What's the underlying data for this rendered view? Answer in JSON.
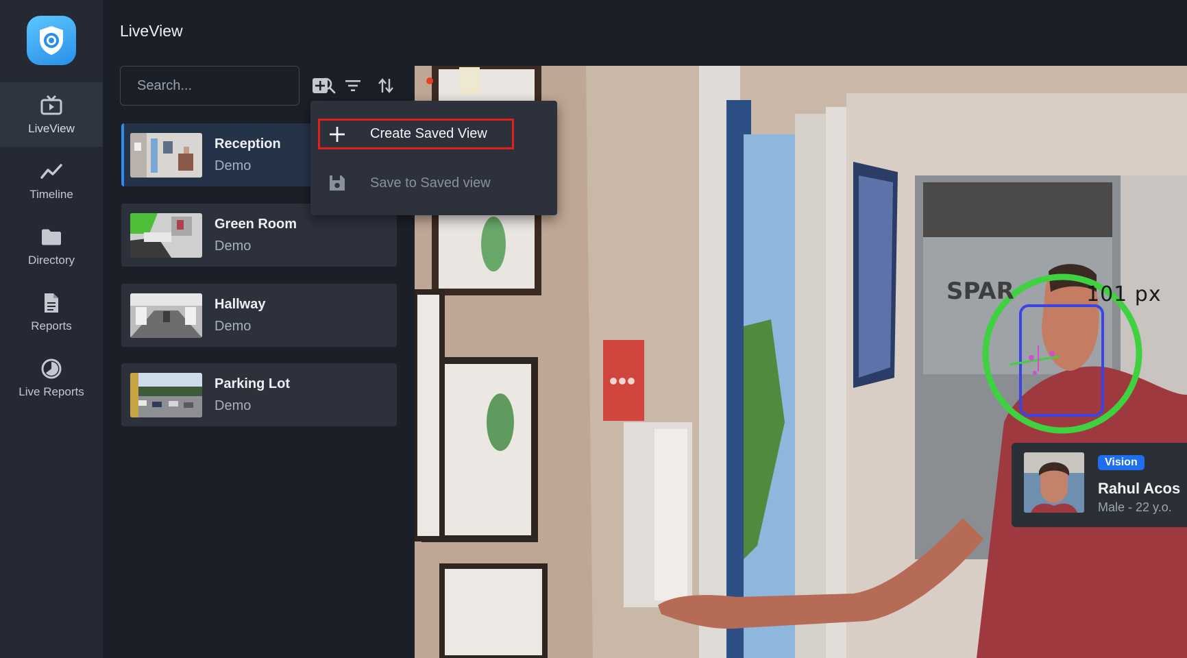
{
  "app": {
    "page_title": "LiveView"
  },
  "nav": {
    "items": [
      {
        "label": "LiveView",
        "icon": "tv-icon",
        "active": true
      },
      {
        "label": "Timeline",
        "icon": "trend-line-icon",
        "active": false
      },
      {
        "label": "Directory",
        "icon": "folder-icon",
        "active": false
      },
      {
        "label": "Reports",
        "icon": "document-icon",
        "active": false
      },
      {
        "label": "Live Reports",
        "icon": "pie-chart-icon",
        "active": false
      }
    ]
  },
  "search": {
    "placeholder": "Search..."
  },
  "cameras": [
    {
      "name": "Reception",
      "group": "Demo",
      "selected": true
    },
    {
      "name": "Green Room",
      "group": "Demo",
      "selected": false
    },
    {
      "name": "Hallway",
      "group": "Demo",
      "selected": false
    },
    {
      "name": "Parking Lot",
      "group": "Demo",
      "selected": false
    }
  ],
  "menu": {
    "create_label": "Create Saved View",
    "save_label": "Save to Saved view"
  },
  "overlay": {
    "measure_label": "101 px",
    "badge": "Vision",
    "person_name": "Rahul Acos",
    "person_meta": "Male - 22 y.o."
  },
  "colors": {
    "accent": "#2d8cf0",
    "highlight_outline": "#e0201d",
    "face_ring": "#3fd13f",
    "face_box": "#3a44e6"
  }
}
